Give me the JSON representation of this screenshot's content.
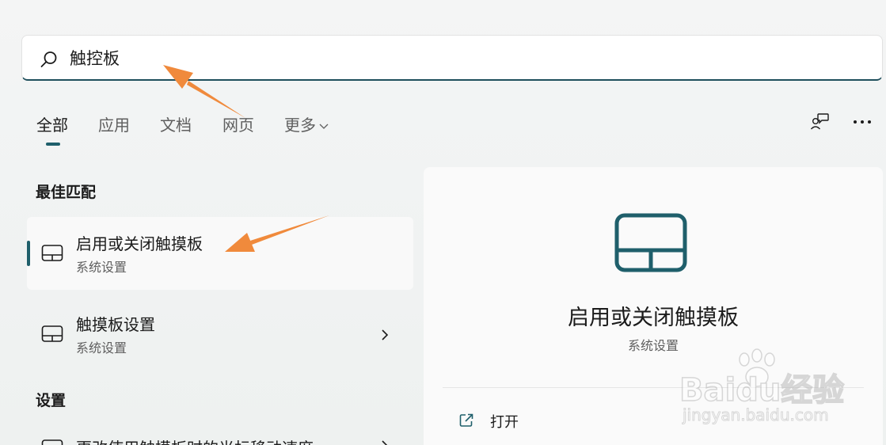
{
  "search": {
    "value": "触控板",
    "icon": "search-icon"
  },
  "tabs": [
    {
      "label": "全部",
      "active": true
    },
    {
      "label": "应用"
    },
    {
      "label": "文档"
    },
    {
      "label": "网页"
    },
    {
      "label": "更多"
    }
  ],
  "sections": {
    "best_match": "最佳匹配",
    "settings": "设置"
  },
  "results": [
    {
      "title": "启用或关闭触摸板",
      "subtitle": "系统设置",
      "icon": "touchpad-icon",
      "selected": true
    },
    {
      "title": "触摸板设置",
      "subtitle": "系统设置",
      "icon": "touchpad-icon",
      "has_chevron": true
    }
  ],
  "settings_results": [
    {
      "title": "更改使用触摸板时的光标移动速度",
      "icon": "touchpad-icon"
    }
  ],
  "detail": {
    "title": "启用或关闭触摸板",
    "subtitle": "系统设置",
    "icon": "touchpad-icon",
    "actions": [
      {
        "label": "打开",
        "icon": "open-external-icon"
      }
    ]
  },
  "colors": {
    "accent": "#1f5f6b",
    "annotation_arrow": "#f08a3c"
  },
  "watermark": {
    "brand": "Baidu经验",
    "url": "jingyan.baidu.com"
  }
}
